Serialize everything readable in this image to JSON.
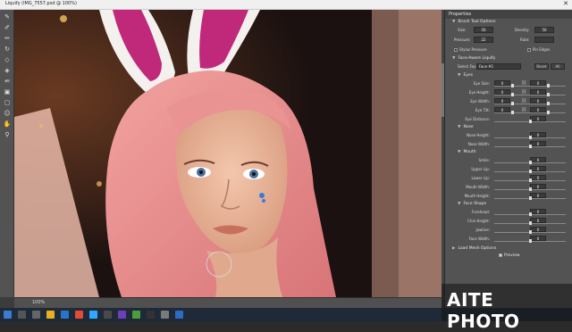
{
  "window": {
    "title": "Liquify (IMG_7557.psd @ 100%)",
    "close_glyph": "✕"
  },
  "toolbox": {
    "tools": [
      "warp-icon",
      "reconstruct-icon",
      "smooth-icon",
      "twirl-icon",
      "pucker-icon",
      "bloat-icon",
      "push-left-icon",
      "freeze-mask-icon",
      "thaw-mask-icon",
      "face-icon",
      "hand-icon",
      "zoom-icon"
    ]
  },
  "status": {
    "zoom": "100%"
  },
  "panel": {
    "title": "Properties",
    "brush_section": "Brush Tool Options",
    "brush": {
      "size_label": "Size:",
      "size_value": "50",
      "density_label": "Density:",
      "density_value": "50",
      "pressure_label": "Pressure:",
      "pressure_value": "22",
      "rate_label": "Rate:",
      "rate_value": "",
      "stylus_label": "Stylus Pressure",
      "pin_label": "Pin Edges"
    },
    "face_section": "Face-Aware Liquify",
    "select_face_label": "Select Face:",
    "select_face_value": "Face #1",
    "reset_label": "Reset",
    "all_label": "All",
    "eyes_label": "Eyes",
    "eyes": [
      {
        "label": "Eye Size:",
        "left": "0",
        "right": "0"
      },
      {
        "label": "Eye Height:",
        "left": "0",
        "right": "0"
      },
      {
        "label": "Eye Width:",
        "left": "0",
        "right": "0"
      },
      {
        "label": "Eye Tilt:",
        "left": "0",
        "right": "0"
      }
    ],
    "eye_distance": {
      "label": "Eye Distance:",
      "value": "0"
    },
    "nose_label": "Nose",
    "nose": [
      {
        "label": "Nose Height:",
        "value": "0"
      },
      {
        "label": "Nose Width:",
        "value": "0"
      }
    ],
    "mouth_label": "Mouth",
    "mouth": [
      {
        "label": "Smile:",
        "value": "0"
      },
      {
        "label": "Upper Lip:",
        "value": "0"
      },
      {
        "label": "Lower Lip:",
        "value": "0"
      },
      {
        "label": "Mouth Width:",
        "value": "0"
      },
      {
        "label": "Mouth Height:",
        "value": "0"
      }
    ],
    "shape_label": "Face Shape",
    "shape": [
      {
        "label": "Forehead:",
        "value": "0"
      },
      {
        "label": "Chin Height:",
        "value": "0"
      },
      {
        "label": "Jawline:",
        "value": "0"
      },
      {
        "label": "Face Width:",
        "value": "0"
      }
    ],
    "load_mesh": "Load Mesh Options",
    "preview_label": "Preview"
  },
  "watermark": {
    "text": "AITE PHOTO"
  },
  "colors": {
    "panel": "#535353",
    "canvas_bg": "#1a1110",
    "hair": "#e89090",
    "ears": "#c0287a"
  }
}
